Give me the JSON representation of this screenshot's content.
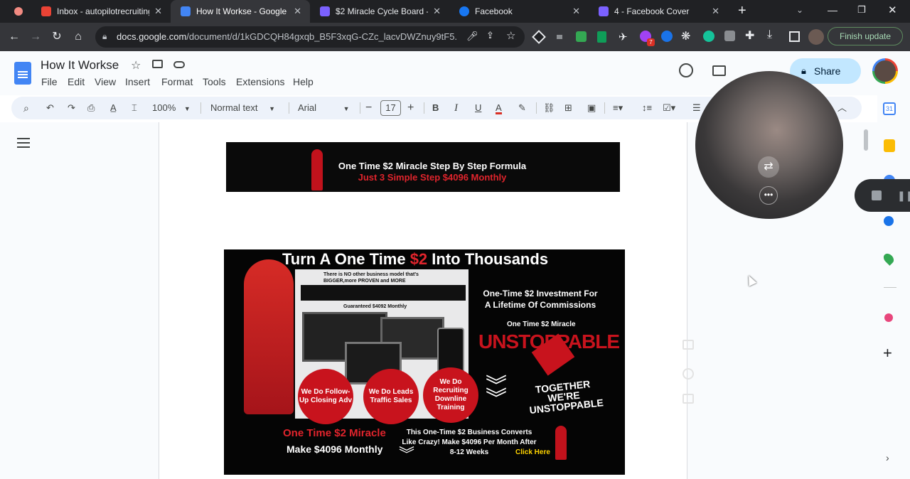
{
  "browser": {
    "tabs": [
      {
        "title": "Inbox - autopilotrecruiting",
        "icon": "gmail-icon",
        "color": "#ea4335",
        "active": false
      },
      {
        "title": "How It Workse - Google Do",
        "icon": "docs-icon",
        "color": "#4285f4",
        "active": true
      },
      {
        "title": "$2 Miracle Cycle Board - F",
        "icon": "heart-icon",
        "color": "#7b61ff",
        "active": false
      },
      {
        "title": "Facebook",
        "icon": "facebook-icon",
        "color": "#1877f2",
        "active": false
      },
      {
        "title": "4 - Facebook Cover",
        "icon": "heart-icon",
        "color": "#7b61ff",
        "active": false
      }
    ],
    "url_domain": "docs.google.com",
    "url_path": "/document/d/1kGDCQH84gxqb_B5F3xqG-CZc_lacvDWZnuy9tF5...",
    "finish_update": "Finish update"
  },
  "docs": {
    "title": "How It Workse",
    "menu": [
      "File",
      "Edit",
      "View",
      "Insert",
      "Format",
      "Tools",
      "Extensions",
      "Help"
    ],
    "share": "Share",
    "zoom": "100%",
    "style": "Normal text",
    "font": "Arial",
    "font_size": "17"
  },
  "banner": {
    "line1": "One Time $2 Miracle Step By Step Formula",
    "line2": "Just 3 Simple Step $4096 Monthly"
  },
  "promo": {
    "headline_a": "Turn A One Time ",
    "headline_b": "$2",
    "headline_c": " Into Thousands",
    "notice": "There is NO other business model that's BIGGER,more PROVEN and MORE",
    "guarantee": "Guaranteed $4092 Monthly",
    "investment": "One-Time $2 Investment For A Lifetime Of Commissions",
    "miracle_small": "One Time $2 Miracle",
    "unstoppable": "UNSTOPPABLE",
    "bubbles": [
      "We Do Follow-Up Closing Adv",
      "We Do Leads Traffic Sales",
      "We Do Recruiting Downline Training"
    ],
    "together": "TOGETHER WE'RE UNSTOPPABLE",
    "footer_a": "One Time $2 Miracle",
    "footer_b": "Make $4096 Monthly",
    "converts": "This One-Time $2 Business Converts Like Crazy! Make $4096 Per Month After 8-12 Weeks",
    "click_here": "Click Here"
  }
}
